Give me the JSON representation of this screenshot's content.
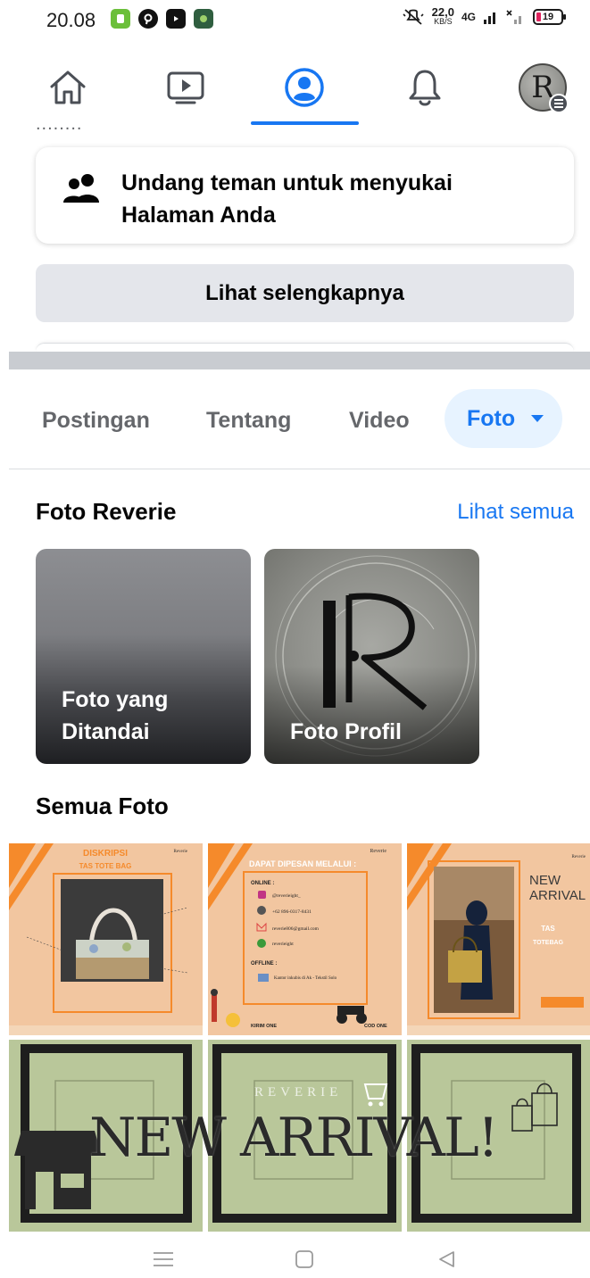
{
  "status_bar": {
    "time": "20.08",
    "speed_value": "22,0",
    "speed_unit": "KB/S",
    "network": "4G",
    "battery": "19"
  },
  "nav": {
    "icons": [
      "home-icon",
      "video-icon",
      "profile-icon",
      "bell-icon",
      "avatar"
    ],
    "active_color": "#1877f2"
  },
  "invite_card": {
    "text": "Undang teman untuk menyukai Halaman Anda"
  },
  "see_more_label": "Lihat selengkapnya",
  "tabs": [
    {
      "label": "Postingan"
    },
    {
      "label": "Tentang"
    },
    {
      "label": "Video"
    },
    {
      "label": "Foto"
    }
  ],
  "photos_section": {
    "title": "Foto Reverie",
    "see_all": "Lihat semua",
    "albums": [
      {
        "label": "Foto yang Ditandai"
      },
      {
        "label": "Foto Profil"
      }
    ]
  },
  "all_photos": {
    "title": "Semua Foto",
    "overlay_text": "NEW ARRIVAL!",
    "brand_text": "REVERIE"
  },
  "grid_texts": {
    "p1_title": "DISKRIPSI",
    "p1_sub": "TAS  TOTE BAG",
    "p2_title": "DAPAT DIPESAN MELALUI :",
    "p2_online": "ONLINE :",
    "p2_ig": "@reverieight_",
    "p2_phone": "+62 896-0317-8431",
    "p2_mail": "reverie806@gmail.com",
    "p2_other": "reverieight",
    "p2_offline": "OFFLINE :",
    "p2_addr": "Kantor inkubis di Ak - Tekstil Solo",
    "p2_kirim": "KIRIM ONE",
    "p2_cod": "COD ONE",
    "p3_new": "NEW",
    "p3_arrival": "ARRIVAL",
    "p3_tas": "TAS",
    "p3_totebag": "TOTEBAG",
    "brand_small": "Reverie"
  },
  "colors": {
    "accent": "#1877f2",
    "peach": "#f2c6a0",
    "orange": "#f58a2b",
    "olive_green": "#b9c79a"
  }
}
